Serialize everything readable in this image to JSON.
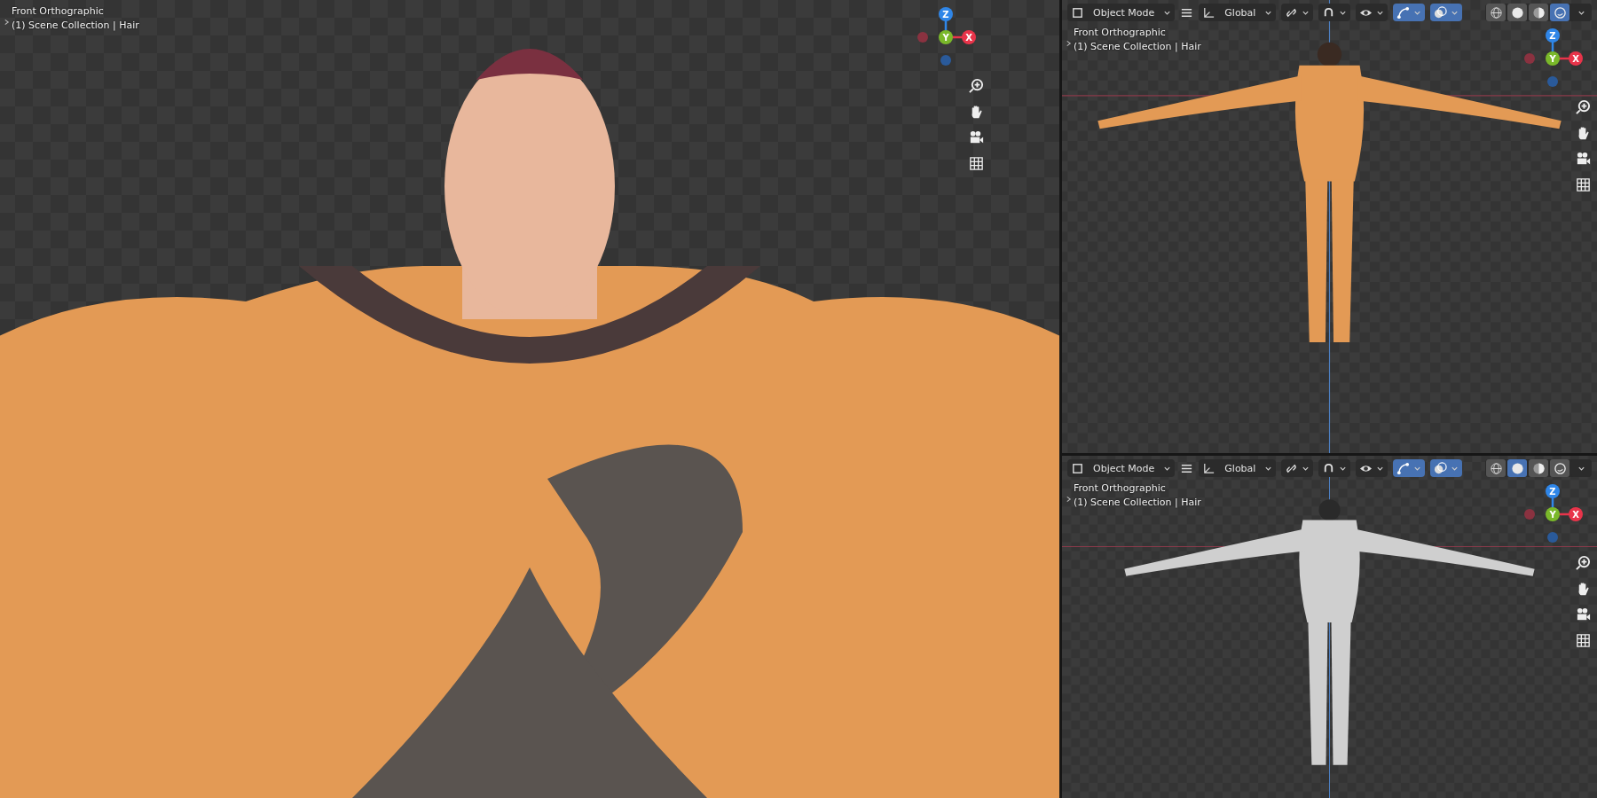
{
  "viewports": [
    {
      "title": "Front Orthographic",
      "collection": "(1) Scene Collection | Hair",
      "gizmo": {
        "z": "Z",
        "y": "Y",
        "x": "X"
      }
    },
    {
      "title": "Front Orthographic",
      "collection": "(1) Scene Collection | Hair",
      "gizmo": {
        "z": "Z",
        "y": "Y",
        "x": "X"
      },
      "header": {
        "mode": "Object Mode",
        "orientation": "Global",
        "toggles": [
          {
            "kind": "snap",
            "on": false
          },
          {
            "kind": "visibility",
            "on": false
          },
          {
            "kind": "gizmo",
            "on": true
          },
          {
            "kind": "overlay",
            "on": true
          }
        ],
        "shading": [
          {
            "kind": "wireframe",
            "selected": false
          },
          {
            "kind": "solid",
            "selected": false
          },
          {
            "kind": "material",
            "selected": false
          },
          {
            "kind": "rendered",
            "selected": true
          }
        ]
      }
    },
    {
      "title": "Front Orthographic",
      "collection": "(1) Scene Collection | Hair",
      "gizmo": {
        "z": "Z",
        "y": "Y",
        "x": "X"
      },
      "header": {
        "mode": "Object Mode",
        "orientation": "Global",
        "toggles": [
          {
            "kind": "snap",
            "on": false
          },
          {
            "kind": "visibility",
            "on": false
          },
          {
            "kind": "gizmo",
            "on": true
          },
          {
            "kind": "overlay",
            "on": true
          }
        ],
        "shading": [
          {
            "kind": "wireframe",
            "selected": false
          },
          {
            "kind": "solid",
            "selected": true
          },
          {
            "kind": "material",
            "selected": false
          },
          {
            "kind": "rendered",
            "selected": false
          }
        ]
      }
    }
  ]
}
